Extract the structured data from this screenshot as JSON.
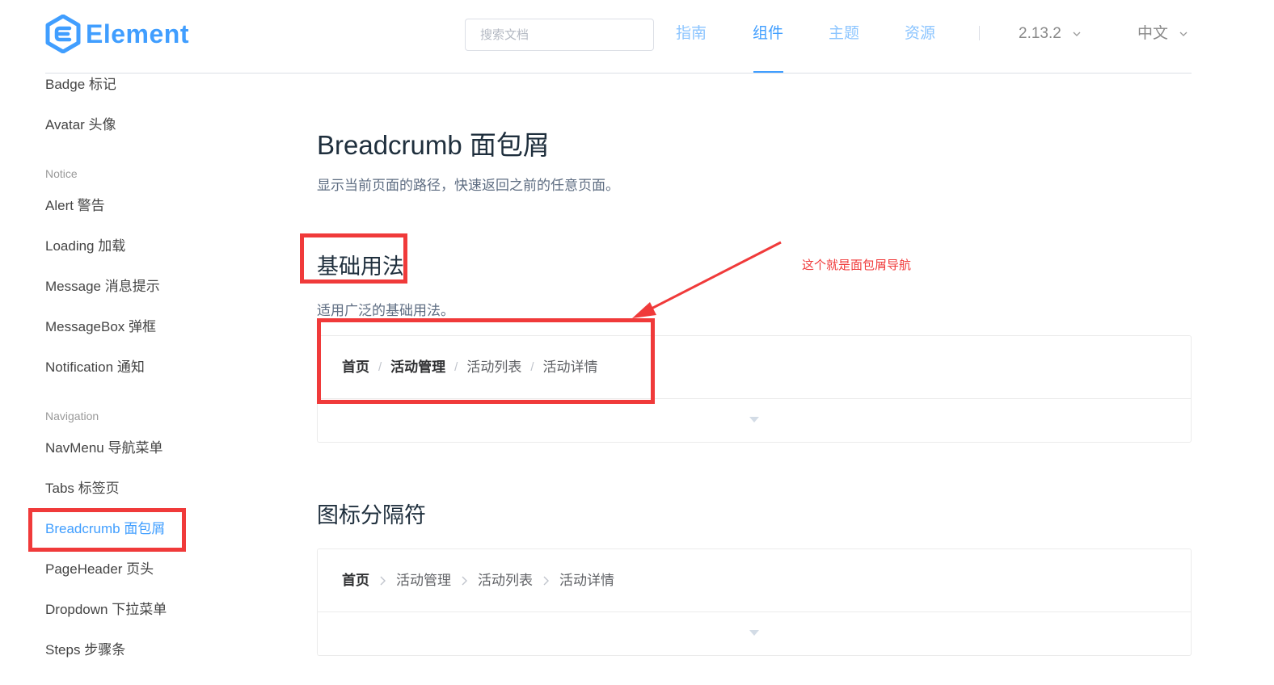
{
  "header": {
    "logo_text": "Element",
    "search_placeholder": "搜索文档",
    "nav": [
      {
        "label": "指南",
        "active": false
      },
      {
        "label": "组件",
        "active": true
      },
      {
        "label": "主题",
        "active": false
      },
      {
        "label": "资源",
        "active": false
      }
    ],
    "version": "2.13.2",
    "language": "中文"
  },
  "sidebar": {
    "items": [
      {
        "label": "Badge 标记"
      },
      {
        "label": "Avatar 头像"
      },
      {
        "group": "Notice"
      },
      {
        "label": "Alert 警告"
      },
      {
        "label": "Loading 加载"
      },
      {
        "label": "Message 消息提示"
      },
      {
        "label": "MessageBox 弹框"
      },
      {
        "label": "Notification 通知"
      },
      {
        "group": "Navigation"
      },
      {
        "label": "NavMenu 导航菜单"
      },
      {
        "label": "Tabs 标签页"
      },
      {
        "label": "Breadcrumb 面包屑",
        "active": true
      },
      {
        "label": "PageHeader 页头"
      },
      {
        "label": "Dropdown 下拉菜单"
      },
      {
        "label": "Steps 步骤条"
      }
    ]
  },
  "main": {
    "title": "Breadcrumb 面包屑",
    "description": "显示当前页面的路径，快速返回之前的任意页面。",
    "sections": [
      {
        "title": "基础用法",
        "description": "适用广泛的基础用法。",
        "separator": "/",
        "crumbs": [
          "首页",
          "活动管理",
          "活动列表",
          "活动详情"
        ]
      },
      {
        "title": "图标分隔符",
        "separator": "arrow-right-icon",
        "crumbs": [
          "首页",
          "活动管理",
          "活动列表",
          "活动详情"
        ]
      }
    ]
  },
  "annotation": {
    "text": "这个就是面包屑导航"
  },
  "colors": {
    "primary": "#409eff",
    "primary_light": "#8cc5ff",
    "annotation_red": "#f03a3a",
    "border": "#ebebeb"
  }
}
